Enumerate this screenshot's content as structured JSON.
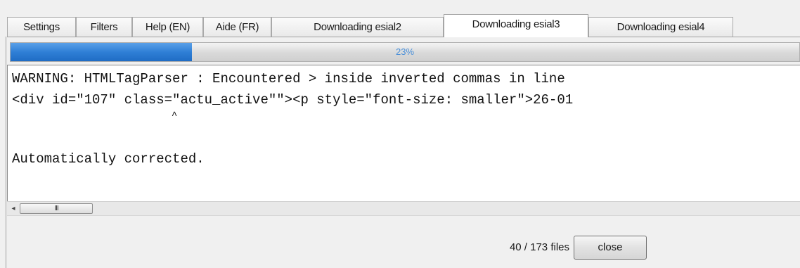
{
  "tabs": [
    {
      "label": "Settings",
      "active": false
    },
    {
      "label": "Filters",
      "active": false
    },
    {
      "label": "Help (EN)",
      "active": false
    },
    {
      "label": "Aide (FR)",
      "active": false
    },
    {
      "label": "Downloading esial2",
      "active": false
    },
    {
      "label": "Downloading esial3",
      "active": true
    },
    {
      "label": "Downloading esial4",
      "active": false
    }
  ],
  "progress": {
    "fraction": 0.23,
    "label": "23%"
  },
  "log": {
    "lines": [
      "WARNING: HTMLTagParser : Encountered > inside inverted commas in line",
      "<div id=\"107\" class=\"actu_active\"\"><p style=\"font-size: smaller\">26-01",
      "                           ^",
      "Automatically corrected."
    ]
  },
  "scrollbar": {
    "left_arrow": "◂",
    "thumb_grip": "III"
  },
  "footer": {
    "file_count": "40 /  173 files",
    "close_label": "close"
  },
  "colors": {
    "progress_fill": "#2f7fd6",
    "progress_text": "#4a8fd8"
  }
}
